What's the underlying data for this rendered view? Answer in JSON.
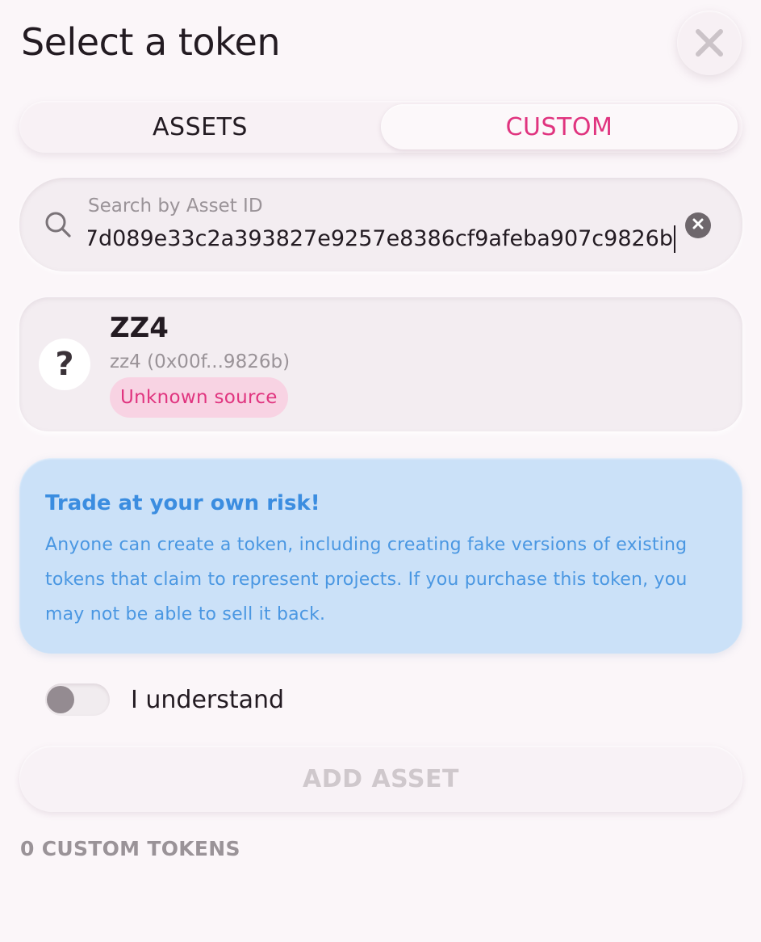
{
  "header": {
    "title": "Select a token",
    "close_icon": "close-icon"
  },
  "tabs": [
    {
      "label": "ASSETS",
      "active": false
    },
    {
      "label": "CUSTOM",
      "active": true
    }
  ],
  "search": {
    "label": "Search by Asset ID",
    "value": "7d089e33c2a393827e9257e8386cf9afeba907c9826b",
    "icon": "search-icon",
    "clear_icon": "clear-icon"
  },
  "token": {
    "avatar_glyph": "?",
    "symbol": "ZZ4",
    "subtitle": "zz4 (0x00f...9826b)",
    "badge": "Unknown source"
  },
  "warning": {
    "title": "Trade at your own risk!",
    "body": "Anyone can create a token, including creating fake versions of existing tokens that claim to represent projects. If you purchase this token, you may not be able to sell it back."
  },
  "confirm": {
    "label": "I understand",
    "checked": false
  },
  "add_button": {
    "label": "ADD ASSET",
    "disabled": true
  },
  "footer": {
    "count_label": "0 CUSTOM TOKENS"
  },
  "colors": {
    "accent": "#e0347f",
    "background": "#fbf6f9",
    "warning_bg": "#cbe1f8",
    "warning_text": "#3b8de0",
    "badge_bg": "#f8d3e3"
  }
}
